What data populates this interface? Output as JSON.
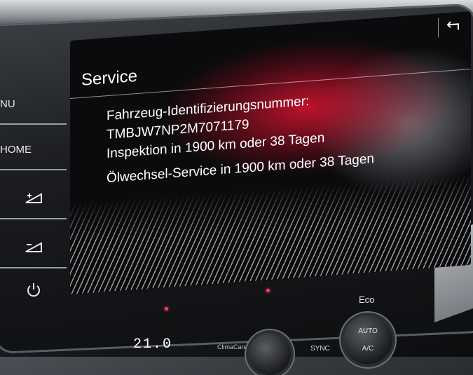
{
  "hardware": {
    "menu_label": "NU",
    "home_label": "HOME"
  },
  "screen": {
    "title": "Service",
    "back_icon": "back-arrow-icon",
    "lines": [
      "Fahrzeug-Identifizierungsnummer:",
      "TMBJW7NP2M7071179",
      "Inspektion in 1900 km oder 38 Tagen",
      "Ölwechsel-Service in 1900 km oder 38 Tagen"
    ]
  },
  "console": {
    "eco_label": "Eco",
    "temperature": "21.0",
    "auto_label": "AUTO",
    "ac_label": "A/C",
    "sync_label": "SYNC",
    "climacare_label": "ClimaCare"
  },
  "colors": {
    "accent_red": "#d8143a",
    "text": "#ffffff"
  }
}
